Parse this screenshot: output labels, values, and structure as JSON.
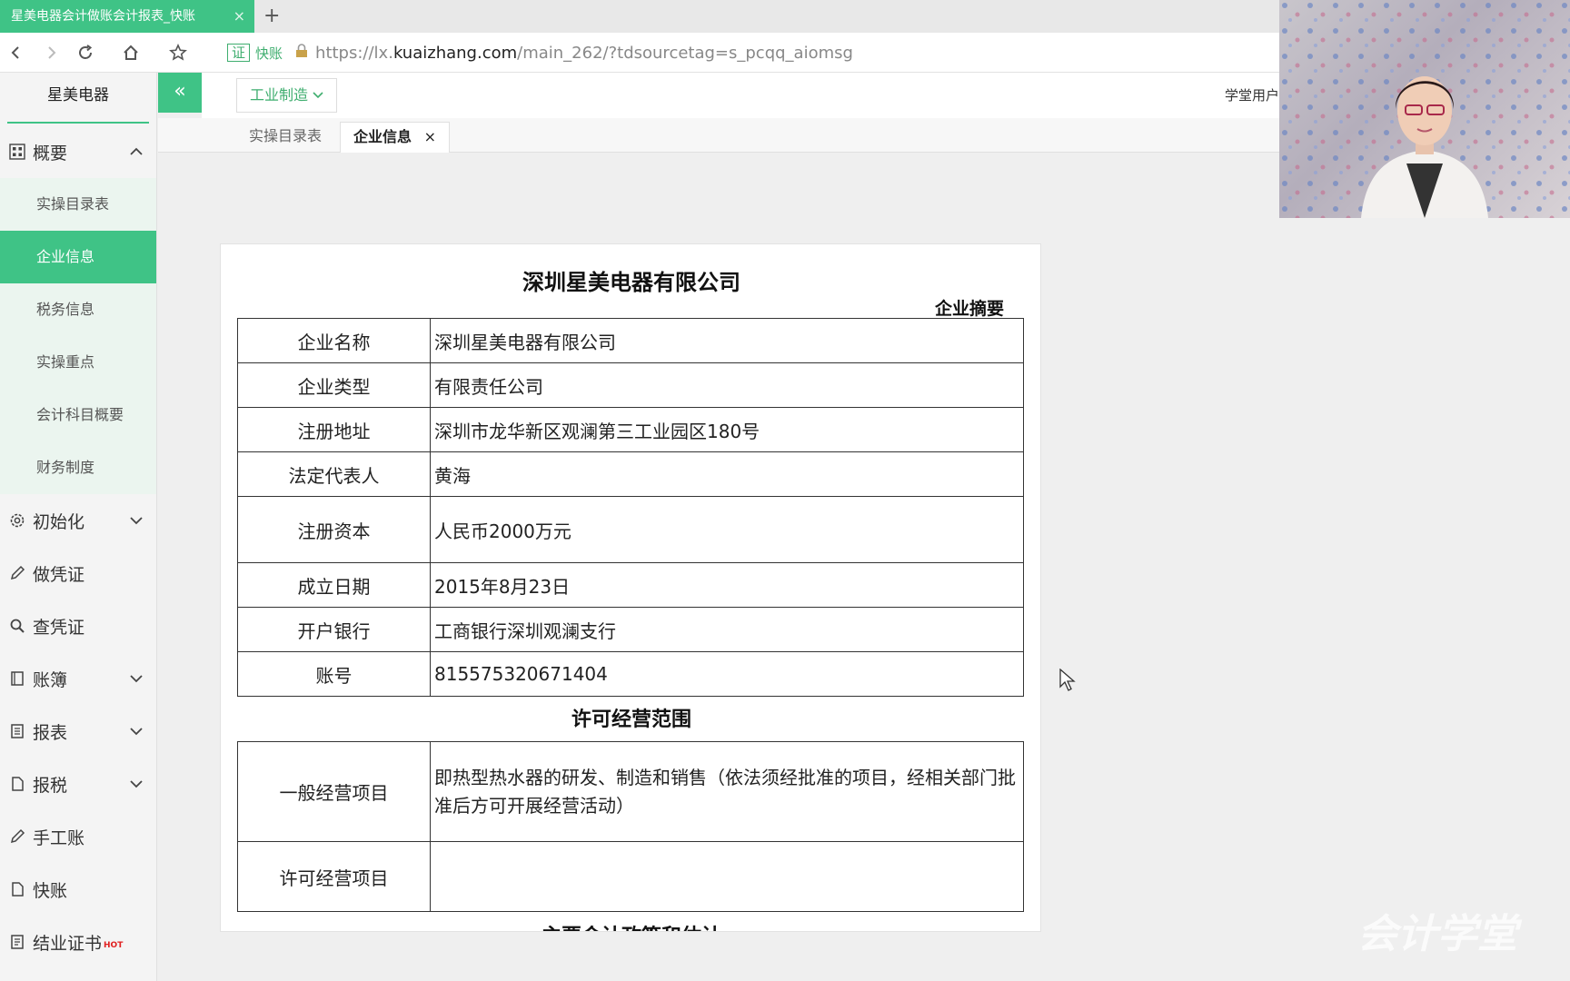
{
  "browser": {
    "tab_title": "星美电器会计做账会计报表_快账",
    "tab_close": "×",
    "new_tab": "+",
    "address": {
      "badge": "证",
      "badge_text": "快账",
      "prefix": "https://lx.",
      "domain": "kuaizhang.com",
      "path": "/main_262/?tdsourcetag=s_pcqq_aiomsg"
    }
  },
  "sidebar": {
    "brand": "星美电器",
    "groups": [
      {
        "label": "概要",
        "icon": "grid-icon",
        "expanded": true,
        "items": [
          {
            "label": "实操目录表",
            "active": false
          },
          {
            "label": "企业信息",
            "active": true
          },
          {
            "label": "税务信息",
            "active": false
          },
          {
            "label": "实操重点",
            "active": false
          },
          {
            "label": "会计科目概要",
            "active": false
          },
          {
            "label": "财务制度",
            "active": false
          }
        ]
      },
      {
        "label": "初始化",
        "icon": "gear-icon"
      },
      {
        "label": "做凭证",
        "icon": "pen-icon"
      },
      {
        "label": "查凭证",
        "icon": "search-icon"
      },
      {
        "label": "账簿",
        "icon": "book-icon"
      },
      {
        "label": "报表",
        "icon": "report-icon"
      },
      {
        "label": "报税",
        "icon": "file-icon"
      },
      {
        "label": "手工账",
        "icon": "pen-icon"
      },
      {
        "label": "快账",
        "icon": "file-icon"
      },
      {
        "label": "结业证书",
        "icon": "certificate-icon",
        "badge": "HOT"
      }
    ]
  },
  "appbar": {
    "collapse": "«",
    "industry": "工业制造",
    "user": "学堂用户"
  },
  "page_tabs": [
    {
      "label": "实操目录表",
      "active": false
    },
    {
      "label": "企业信息",
      "active": true,
      "close": "×"
    }
  ],
  "document": {
    "title": "深圳星美电器有限公司",
    "subtitle": "企业摘要",
    "info_rows": [
      {
        "key": "企业名称",
        "value": "深圳星美电器有限公司"
      },
      {
        "key": "企业类型",
        "value": "有限责任公司"
      },
      {
        "key": "注册地址",
        "value": "深圳市龙华新区观澜第三工业园区180号"
      },
      {
        "key": "法定代表人",
        "value": "黄海"
      },
      {
        "key": "注册资本",
        "value": "人民币2000万元"
      },
      {
        "key": "成立日期",
        "value": "2015年8月23日"
      },
      {
        "key": "开户银行",
        "value": "工商银行深圳观澜支行"
      },
      {
        "key": "账号",
        "value": "815575320671404"
      }
    ],
    "scope_title": "许可经营范围",
    "scope_rows": [
      {
        "key": "一般经营项目",
        "value": "即热型热水器的研发、制造和销售（依法须经批准的项目，经相关部门批准后方可开展经营活动）"
      },
      {
        "key": "许可经营项目",
        "value": ""
      }
    ],
    "next_section": "主要会计政策和估计"
  },
  "overlay": {
    "watermark": "会计学堂"
  }
}
